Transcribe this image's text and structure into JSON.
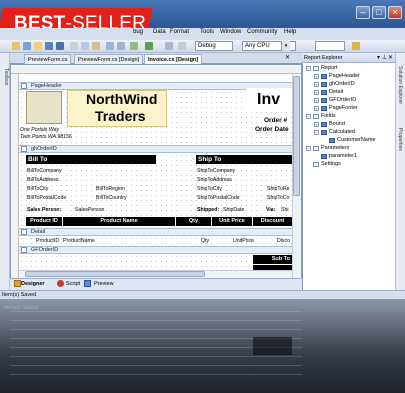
{
  "banner": {
    "word1": "BEST",
    "word2": "-SELLER"
  },
  "menu": [
    "bug",
    "Data",
    "Format",
    "Tools",
    "Window",
    "Community",
    "Help"
  ],
  "toolbar": {
    "config": "Debug",
    "platform": "Any CPU"
  },
  "left_strip": "Toolbox",
  "doc_tabs": [
    "PreviewForm.cs",
    "PreviewForm.cs [Design]",
    "Invoice.cs [Design]"
  ],
  "bands": {
    "page_header": "PageHeader",
    "group_header": "ghOrderID",
    "detail": "Detail",
    "group_footer": "GFOrderID"
  },
  "report": {
    "company": [
      "NorthWind",
      "Traders"
    ],
    "title": "Inv",
    "address": [
      "One Portals Way",
      "Twin Points WA  98156"
    ],
    "order_labels": [
      "Order #",
      "Order Date"
    ],
    "bill_to": "Bill To",
    "ship_to": "Ship To",
    "bill_fields": [
      "BillToCompany",
      "BillToAddress",
      "BillToCity",
      "BillToPostalCode"
    ],
    "bill_fields2": [
      "BillToRegion",
      "BillToCountry"
    ],
    "ship_fields": [
      "ShipToCompany",
      "ShipToAddress",
      "ShipToCity",
      "ShipToPostalCode"
    ],
    "ship_fields2": [
      "ShipToRe",
      "ShipToCo"
    ],
    "sales_label": "Sales Person:",
    "sales_value": "SalesPerson",
    "shipped_label": "Shipped:",
    "shipped_value": "ShipDate",
    "via_label": "Via:",
    "via_value": "Shi",
    "table_headers": [
      "Product ID",
      "Product Name",
      "Qty",
      "Unit Price",
      "Discount"
    ],
    "detail_fields": [
      "ProductID",
      "ProductName",
      "Qty",
      "UnitPrice",
      "Disco"
    ],
    "subtotal": "Sub To"
  },
  "designer_tabs": [
    "Designer",
    "Script",
    "Preview"
  ],
  "explorer": {
    "title": "Report Explorer",
    "pin": "✕",
    "nodes": [
      {
        "label": "Report",
        "level": 0,
        "toggle": "−"
      },
      {
        "label": "PageHeader",
        "level": 1,
        "toggle": "+"
      },
      {
        "label": "ghOrderID",
        "level": 1,
        "toggle": "+"
      },
      {
        "label": "Detail",
        "level": 1,
        "toggle": "+"
      },
      {
        "label": "GFOrderID",
        "level": 1,
        "toggle": "+"
      },
      {
        "label": "PageFooter",
        "level": 1,
        "toggle": "+"
      },
      {
        "label": "Fields",
        "level": 0,
        "toggle": "−"
      },
      {
        "label": "Bound",
        "level": 1,
        "toggle": "+"
      },
      {
        "label": "Calculated",
        "level": 1,
        "toggle": "−"
      },
      {
        "label": "CustomerName",
        "level": 2,
        "toggle": ""
      },
      {
        "label": "Parameters",
        "level": 0,
        "toggle": "−"
      },
      {
        "label": "parameter1",
        "level": 1,
        "toggle": ""
      },
      {
        "label": "Settings",
        "level": 0,
        "toggle": ""
      }
    ]
  },
  "right_strip": [
    "Solution Explorer",
    "Properties"
  ],
  "status": "Item(s) Saved"
}
